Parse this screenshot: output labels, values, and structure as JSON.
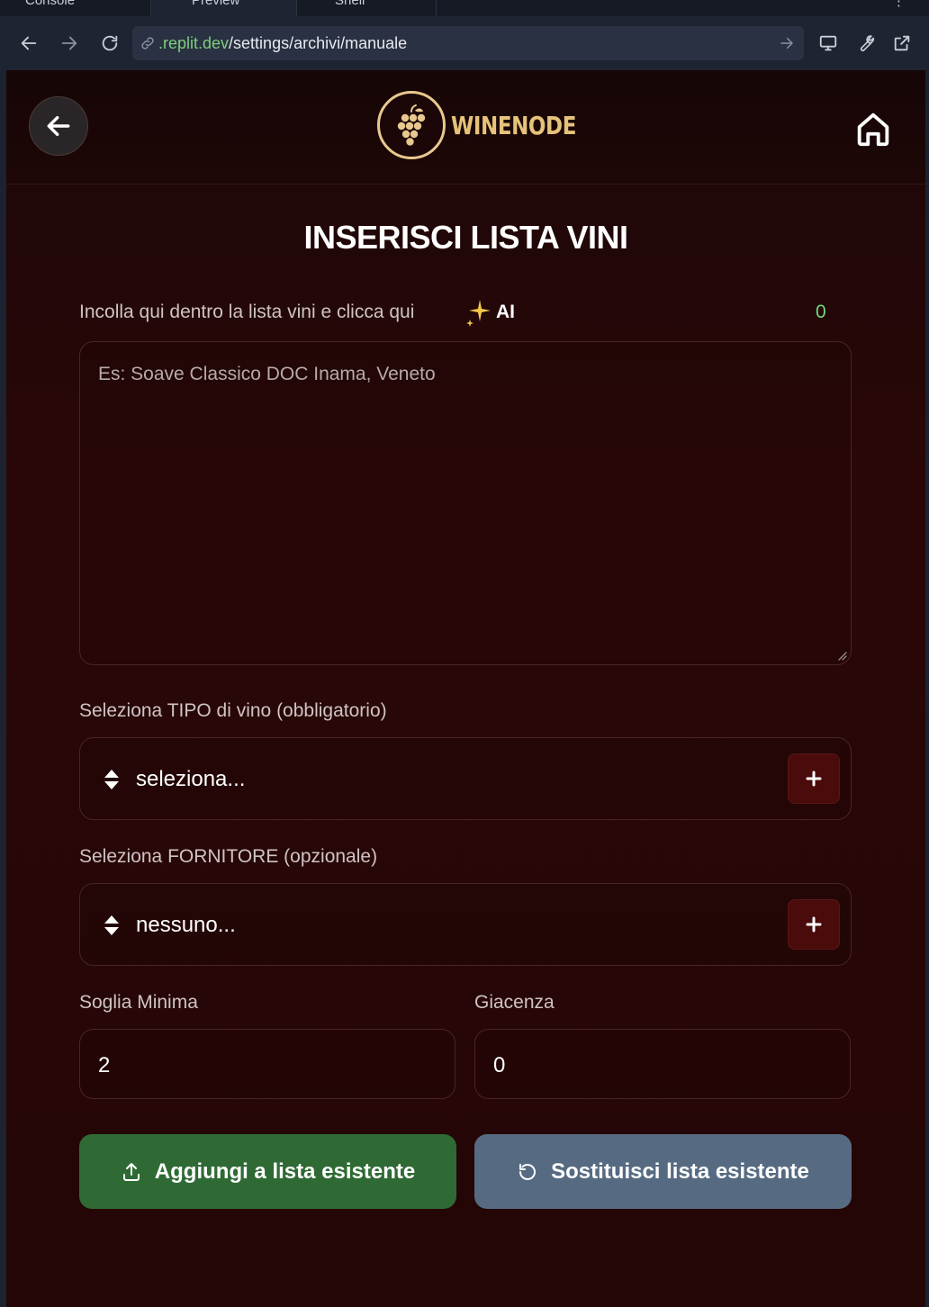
{
  "browser": {
    "tabs": [
      "Console",
      "Preview",
      "Shell"
    ],
    "tab_icons": [
      "terminal-icon",
      "preview-icon",
      "shell-icon"
    ],
    "url": {
      "domain": ".replit.dev",
      "path": "/settings/archivi/manuale"
    }
  },
  "header": {
    "logo_text": "WINENODE"
  },
  "page": {
    "title": "INSERISCI LISTA VINI"
  },
  "import": {
    "label": "Incolla qui dentro la lista vini e clicca qui",
    "ai_label": "AI",
    "counter": "0",
    "placeholder": "Es: Soave Classico DOC Inama, Veneto"
  },
  "wine_type": {
    "label": "Seleziona TIPO di vino (obbligatorio)",
    "value": "seleziona..."
  },
  "supplier": {
    "label": "Seleziona FORNITORE (opzionale)",
    "value": "nessuno..."
  },
  "threshold": {
    "label": "Soglia Minima",
    "value": "2"
  },
  "stock": {
    "label": "Giacenza",
    "value": "0"
  },
  "actions": {
    "add_label": "Aggiungi a lista esistente",
    "replace_label": "Sostituisci lista esistente"
  },
  "colors": {
    "background": "#2a0707",
    "accent_gold": "#e6c27a",
    "add_button": "#2f6a34",
    "replace_button": "#566b82",
    "counter_green": "#73d77a"
  }
}
